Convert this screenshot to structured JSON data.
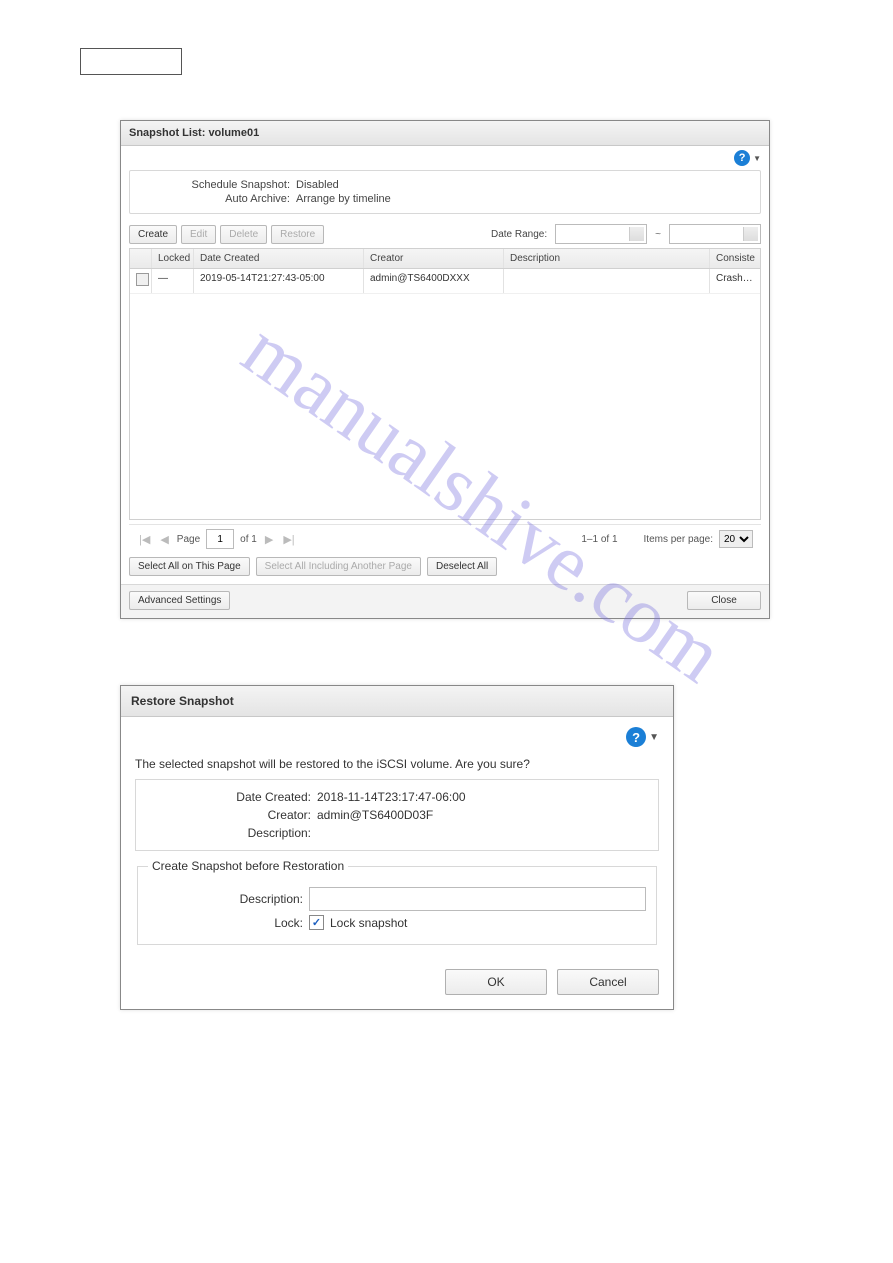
{
  "watermark": "manualshive.com",
  "snapshot_list": {
    "title": "Snapshot List: volume01",
    "schedule_label": "Schedule Snapshot:",
    "schedule_value": "Disabled",
    "archive_label": "Auto Archive:",
    "archive_value": "Arrange by timeline",
    "toolbar": {
      "create": "Create",
      "edit": "Edit",
      "delete": "Delete",
      "restore": "Restore",
      "date_range_label": "Date Range:",
      "tilde": "~"
    },
    "columns": {
      "locked": "Locked",
      "date_created": "Date Created",
      "creator": "Creator",
      "description": "Description",
      "consistency": "Consiste"
    },
    "rows": [
      {
        "locked": "—",
        "date_created": "2019-05-14T21:27:43-05:00",
        "creator": "admin@TS6400DXXX",
        "description": "",
        "consistency": "Crash…"
      }
    ],
    "pager": {
      "page_label": "Page",
      "page_value": "1",
      "of_label": "of 1",
      "range": "1–1 of 1",
      "items_label": "Items per page:",
      "items_value": "20"
    },
    "selection": {
      "all_page": "Select All on This Page",
      "all_incl": "Select All Including Another Page",
      "deselect": "Deselect All"
    },
    "footer": {
      "advanced": "Advanced Settings",
      "close": "Close"
    }
  },
  "restore": {
    "title": "Restore Snapshot",
    "message": "The selected snapshot will be restored to the iSCSI volume. Are you sure?",
    "date_label": "Date Created:",
    "date_value": "2018-11-14T23:17:47-06:00",
    "creator_label": "Creator:",
    "creator_value": "admin@TS6400D03F",
    "desc_label": "Description:",
    "fieldset_legend": "Create Snapshot before Restoration",
    "fs_desc_label": "Description:",
    "fs_lock_label": "Lock:",
    "fs_lock_text": "Lock snapshot",
    "fs_lock_checked": true,
    "ok": "OK",
    "cancel": "Cancel"
  },
  "help_glyph": "?",
  "check_glyph": "✓"
}
